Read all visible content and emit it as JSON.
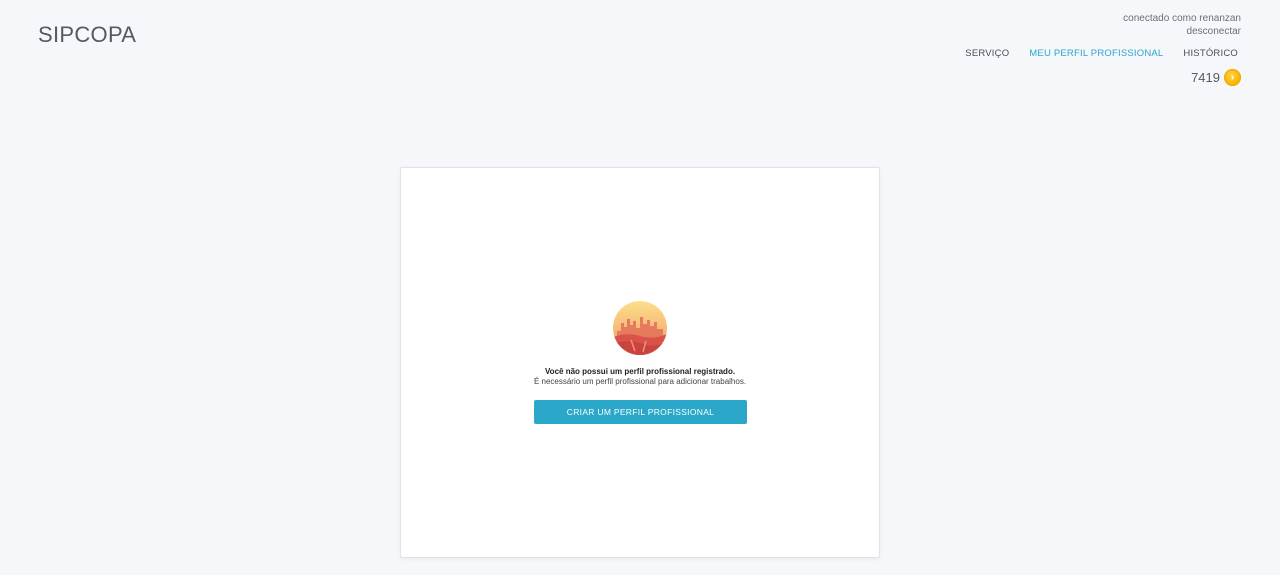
{
  "header": {
    "brand": "SIPCOPA",
    "account": {
      "connected_text": "conectado como renanzan",
      "logout_label": "desconectar"
    },
    "nav": [
      {
        "label": "SERVIÇO",
        "active": false
      },
      {
        "label": "MEU PERFIL PROFISSIONAL",
        "active": true
      },
      {
        "label": "HISTÓRICO",
        "active": false
      }
    ],
    "credits": {
      "value": "7419",
      "icon": "coin-icon"
    }
  },
  "empty_state": {
    "illustration": "city-skyline-illustration",
    "title": "Você não possui um perfil profissional registrado.",
    "subtitle": "É necessário um perfil profissional para adicionar trabalhos.",
    "button_label": "CRIAR UM PERFIL PROFISSIONAL"
  },
  "colors": {
    "accent": "#2aa7c9",
    "background": "#f6f7fb",
    "coin": "#f7b500"
  }
}
